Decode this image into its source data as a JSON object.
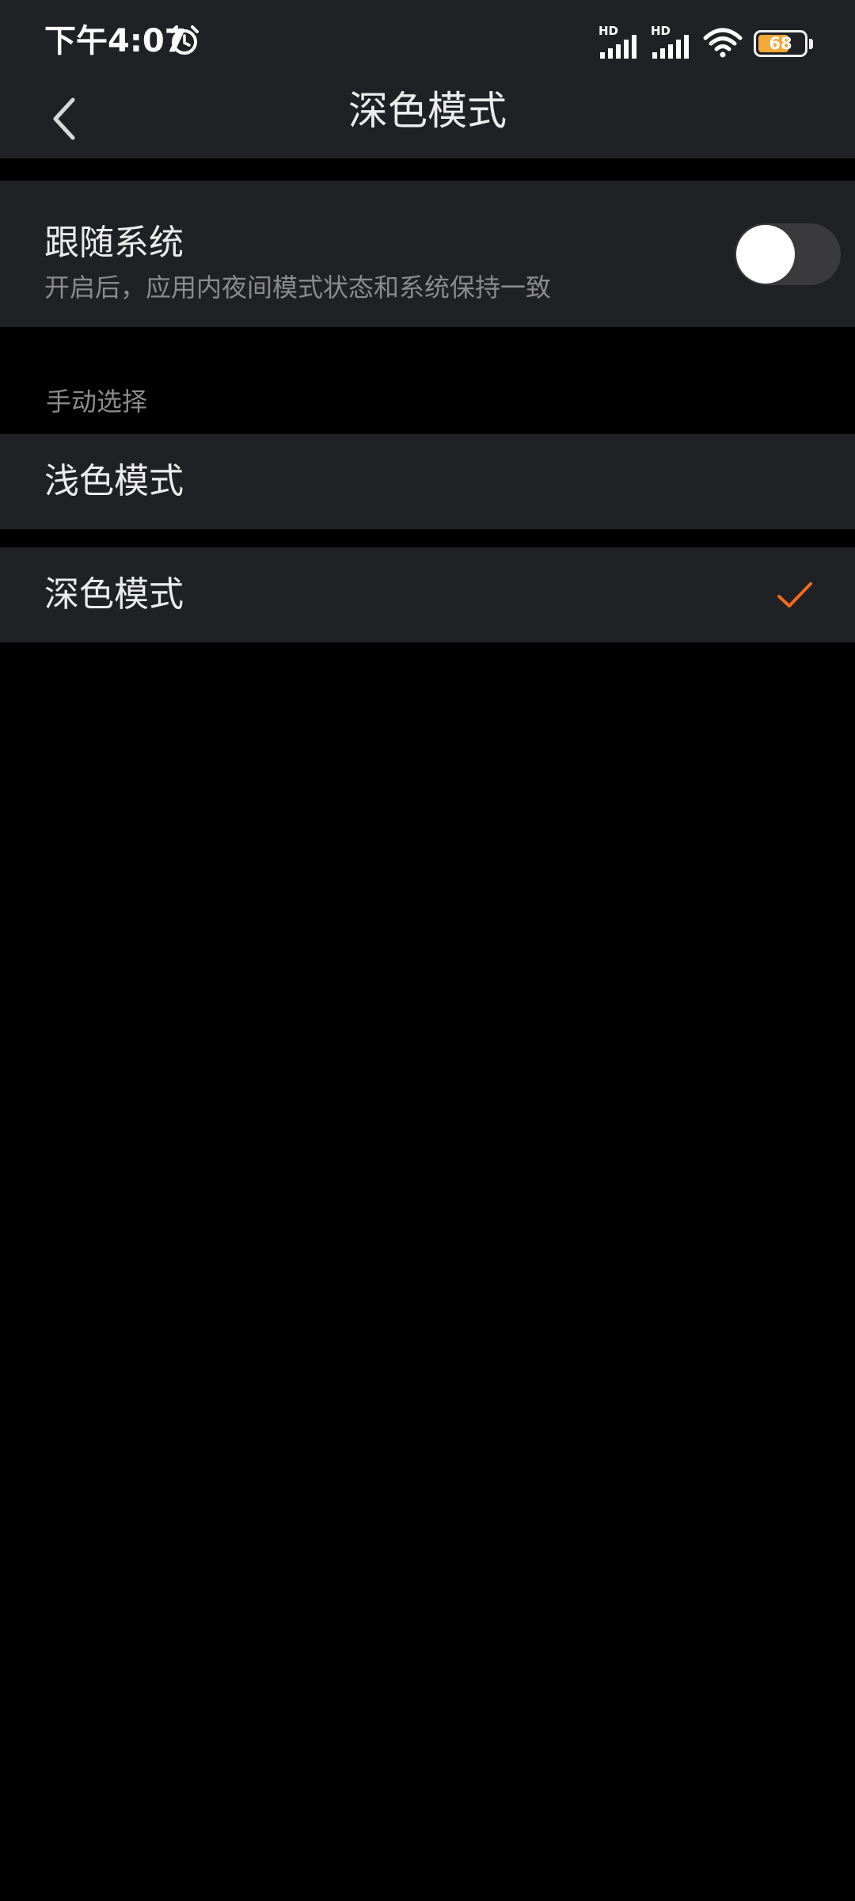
{
  "status_bar": {
    "time": "下午4:07",
    "signal_1_label": "HD",
    "signal_2_label": "HD",
    "battery_level": "68",
    "battery_fraction": 0.68
  },
  "header": {
    "title": "深色模式",
    "back_icon": "chevron-left-icon"
  },
  "follow_system": {
    "title": "跟随系统",
    "subtitle": "开启后，应用内夜间模式状态和系统保持一致",
    "enabled": false
  },
  "manual": {
    "section_label": "手动选择",
    "options": [
      {
        "label": "浅色模式",
        "selected": false
      },
      {
        "label": "深色模式",
        "selected": true
      }
    ]
  },
  "colors": {
    "background": "#000000",
    "panel": "#202124",
    "accent": "#f26b1d",
    "battery": "#f2a83b"
  }
}
